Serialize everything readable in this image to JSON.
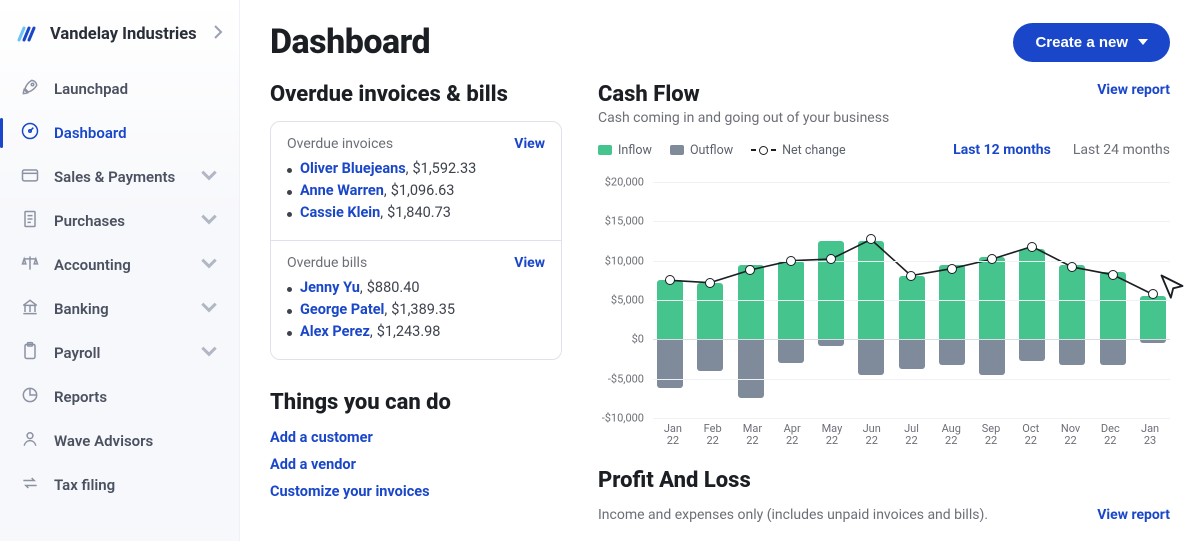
{
  "sidebar": {
    "company": "Vandelay Industries",
    "items": [
      {
        "label": "Launchpad",
        "icon": "rocket"
      },
      {
        "label": "Dashboard",
        "icon": "gauge",
        "active": true
      },
      {
        "label": "Sales & Payments",
        "icon": "card",
        "expandable": true
      },
      {
        "label": "Purchases",
        "icon": "receipt",
        "expandable": true
      },
      {
        "label": "Accounting",
        "icon": "scale",
        "expandable": true
      },
      {
        "label": "Banking",
        "icon": "bank",
        "expandable": true
      },
      {
        "label": "Payroll",
        "icon": "clipboard",
        "expandable": true
      },
      {
        "label": "Reports",
        "icon": "pie"
      },
      {
        "label": "Wave Advisors",
        "icon": "person"
      },
      {
        "label": "Tax filing",
        "icon": "swap"
      }
    ]
  },
  "header": {
    "title": "Dashboard",
    "create_btn": "Create a new"
  },
  "overdue": {
    "heading": "Overdue invoices & bills",
    "invoices_title": "Overdue invoices",
    "bills_title": "Overdue bills",
    "view": "View",
    "invoices": [
      {
        "name": "Oliver Bluejeans",
        "amount": "$1,592.33"
      },
      {
        "name": "Anne Warren",
        "amount": "$1,096.63"
      },
      {
        "name": "Cassie Klein",
        "amount": "$1,840.73"
      }
    ],
    "bills": [
      {
        "name": "Jenny Yu",
        "amount": "$880.40"
      },
      {
        "name": "George Patel",
        "amount": "$1,389.35"
      },
      {
        "name": "Alex Perez",
        "amount": "$1,243.98"
      }
    ]
  },
  "things": {
    "heading": "Things you can do",
    "actions": [
      "Add a customer",
      "Add a vendor",
      "Customize your invoices"
    ]
  },
  "cashflow": {
    "title": "Cash Flow",
    "subtitle": "Cash coming in and going out of your business",
    "view_report": "View report",
    "legend": {
      "inflow": "Inflow",
      "outflow": "Outflow",
      "net": "Net change"
    },
    "ranges": {
      "r12": "Last 12 months",
      "r24": "Last 24 months"
    },
    "y_ticks": [
      "$20,000",
      "$15,000",
      "$10,000",
      "$5,000",
      "$0",
      "-$5,000",
      "-$10,000"
    ]
  },
  "pl": {
    "title": "Profit And Loss",
    "subtitle": "Income and expenses only (includes unpaid invoices and bills).",
    "view_report": "View report"
  },
  "chart_data": {
    "type": "bar",
    "title": "Cash Flow",
    "ylabel": "",
    "ylim": [
      -10000,
      20000
    ],
    "categories": [
      "Jan 22",
      "Feb 22",
      "Mar 22",
      "Apr 22",
      "May 22",
      "Jun 22",
      "Jul 22",
      "Aug 22",
      "Sep 22",
      "Oct 22",
      "Nov 22",
      "Dec 22",
      "Jan 23"
    ],
    "series": [
      {
        "name": "Inflow",
        "values": [
          7500,
          7200,
          9500,
          10000,
          12500,
          12500,
          8100,
          9500,
          10500,
          11500,
          9500,
          8500,
          5500
        ]
      },
      {
        "name": "Outflow",
        "values": [
          -6200,
          -4000,
          -7500,
          -3000,
          -800,
          -4500,
          -3800,
          -3200,
          -4500,
          -2800,
          -3200,
          -3200,
          -500
        ]
      },
      {
        "name": "Net change",
        "values": [
          7500,
          7200,
          8800,
          10000,
          10200,
          12700,
          8100,
          9000,
          10200,
          11800,
          9200,
          8200,
          5700
        ]
      }
    ]
  }
}
